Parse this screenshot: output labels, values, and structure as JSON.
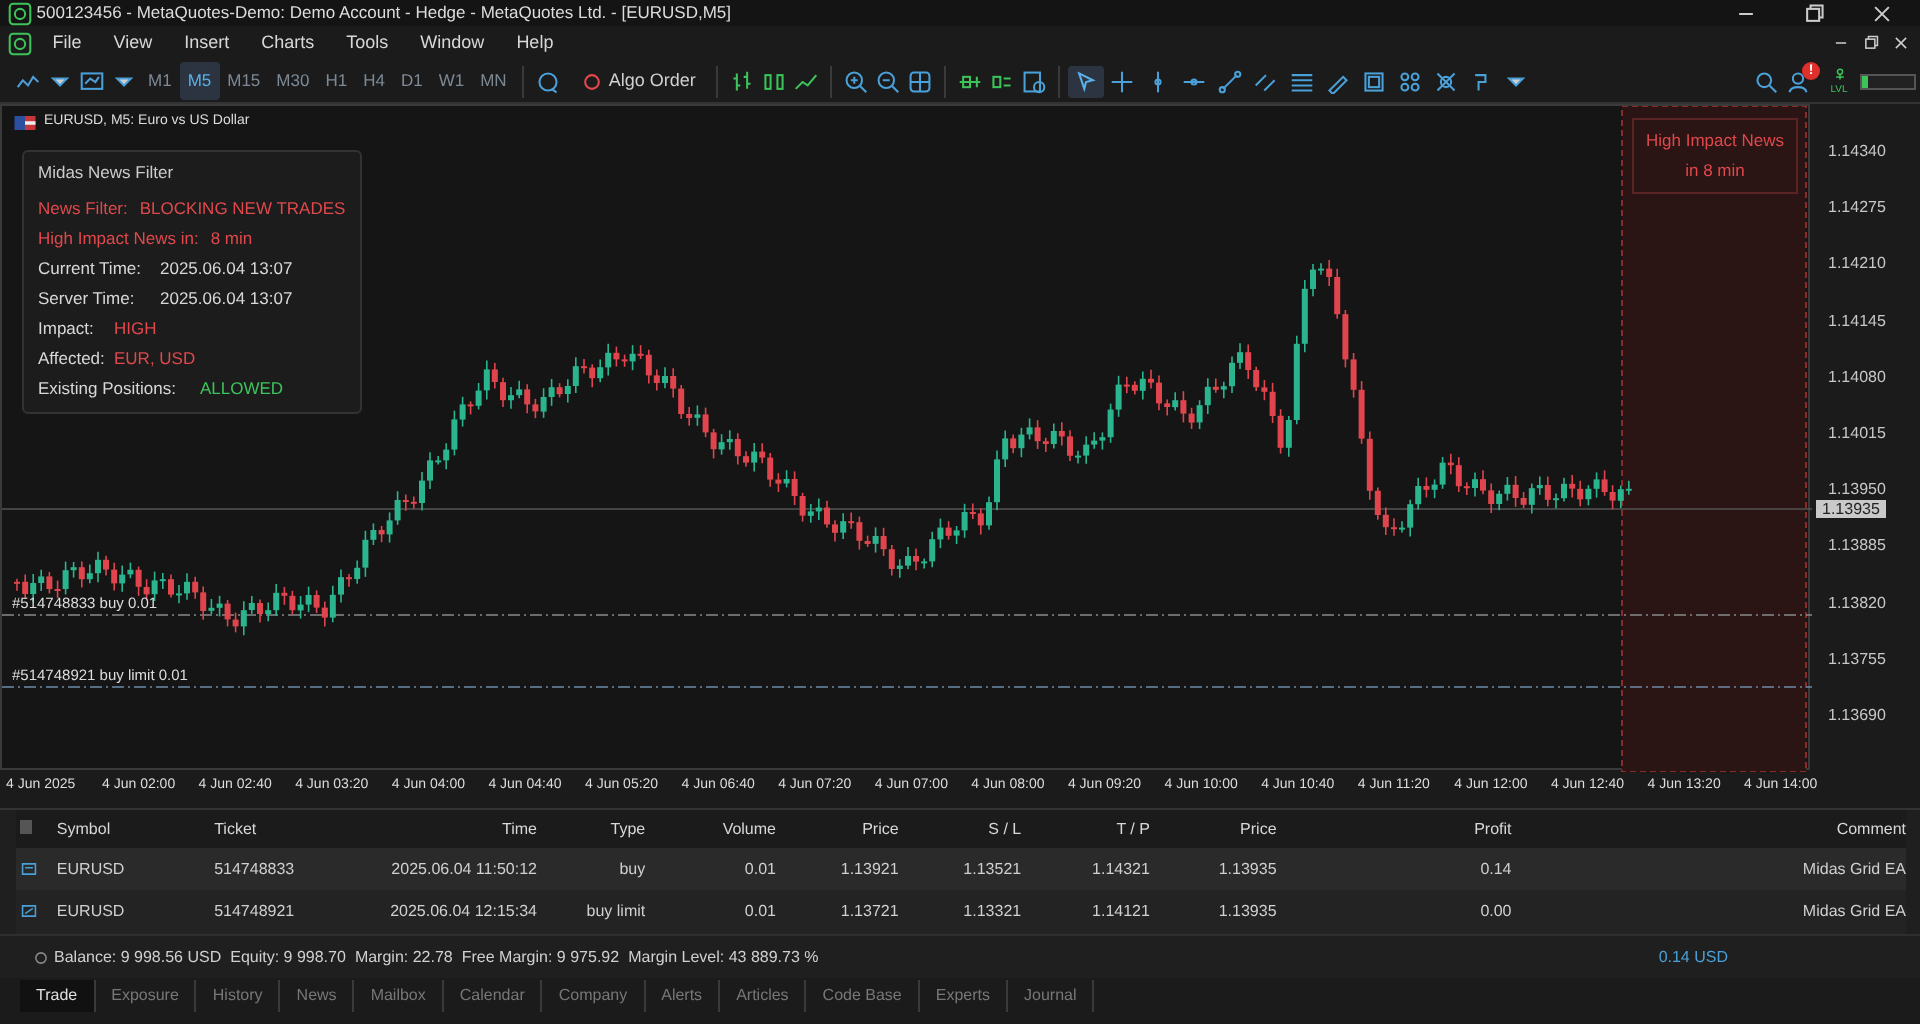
{
  "window": {
    "title": "500123456 - MetaQuotes-Demo: Demo Account - Hedge - MetaQuotes Ltd. - [EURUSD,M5]"
  },
  "menu": [
    "File",
    "View",
    "Insert",
    "Charts",
    "Tools",
    "Window",
    "Help"
  ],
  "toolbar": {
    "timeframes": [
      {
        "label": "M1",
        "selected": false
      },
      {
        "label": "M5",
        "selected": true
      },
      {
        "label": "M15",
        "selected": false
      },
      {
        "label": "M30",
        "selected": false
      },
      {
        "label": "H1",
        "selected": false
      },
      {
        "label": "H4",
        "selected": false
      },
      {
        "label": "D1",
        "selected": false
      },
      {
        "label": "W1",
        "selected": false
      },
      {
        "label": "MN",
        "selected": false
      }
    ],
    "algo_order": "Algo Order",
    "drawing_tools": [
      {
        "kind": "cursor",
        "selected": true
      },
      {
        "kind": "crosshair",
        "selected": false
      },
      {
        "kind": "vline",
        "selected": false
      },
      {
        "kind": "hline",
        "selected": false
      },
      {
        "kind": "trend",
        "selected": false
      },
      {
        "kind": "channel",
        "selected": false
      },
      {
        "kind": "fibo",
        "selected": false
      },
      {
        "kind": "pen",
        "selected": false
      },
      {
        "kind": "rect",
        "selected": false
      },
      {
        "kind": "shapes",
        "selected": false
      },
      {
        "kind": "pattern",
        "selected": false
      },
      {
        "kind": "dots",
        "selected": false
      }
    ],
    "notification_badge": "!",
    "level_label": "LVL",
    "level": 0.12
  },
  "chart": {
    "title": "EURUSD, M5: Euro vs US Dollar",
    "news_panel": {
      "title": "Midas News Filter",
      "rows": [
        {
          "label": "News Filter:",
          "value": "BLOCKING NEW TRADES",
          "kind": "alert",
          "color": "#e0484c"
        },
        {
          "label": "High Impact News in:",
          "value": "8 min",
          "kind": "alert",
          "color": "#e0484c"
        },
        {
          "label": "Current Time:",
          "value": "2025.06.04 13:07",
          "kind": "info",
          "color": "#d8d8d8"
        },
        {
          "label": "Server Time:",
          "value": "2025.06.04 13:07",
          "kind": "info",
          "color": "#d8d8d8"
        },
        {
          "label": "Impact:",
          "value": "HIGH",
          "kind": "info",
          "color": "#e0484c"
        },
        {
          "label": "Affected:",
          "value": "EUR, USD",
          "kind": "info",
          "color": "#e0484c"
        },
        {
          "label": "Existing Positions:",
          "value": "ALLOWED",
          "kind": "info",
          "color": "#3cc45a"
        }
      ]
    },
    "news_zone": [
      "High Impact News",
      "in 8 min"
    ],
    "order_lines": [
      "#514748833 buy 0.01",
      "#514748921 buy limit 0.01"
    ],
    "price_axis": [
      "1.14340",
      "1.14275",
      "1.14210",
      "1.14145",
      "1.14080",
      "1.14015",
      "1.13950",
      "1.13885",
      "1.13820",
      "1.13755",
      "1.13690"
    ],
    "current_price": "1.13935",
    "time_axis": [
      "4 Jun 2025",
      "4 Jun 02:00",
      "4 Jun 02:40",
      "4 Jun 03:20",
      "4 Jun 04:00",
      "4 Jun 04:40",
      "4 Jun 05:20",
      "4 Jun 06:40",
      "4 Jun 07:20",
      "4 Jun 07:00",
      "4 Jun 08:00",
      "4 Jun 09:20",
      "4 Jun 10:00",
      "4 Jun 10:40",
      "4 Jun 11:20",
      "4 Jun 12:00",
      "4 Jun 12:40",
      "4 Jun 13:20",
      "4 Jun 14:00"
    ]
  },
  "trade": {
    "columns": [
      "Symbol",
      "Ticket",
      "Time",
      "Type",
      "Volume",
      "Price",
      "S / L",
      "T / P",
      "Price",
      "Profit",
      "Comment"
    ],
    "rows": [
      {
        "kind": "position",
        "cells": [
          "EURUSD",
          "514748833",
          "2025.06.04 11:50:12",
          "buy",
          "0.01",
          "1.13921",
          "1.13521",
          "1.14321",
          "1.13935",
          "0.14",
          "Midas Grid EA"
        ]
      },
      {
        "kind": "order",
        "cells": [
          "EURUSD",
          "514748921",
          "2025.06.04 12:15:34",
          "buy limit",
          "0.01",
          "1.13721",
          "1.13321",
          "1.14121",
          "1.13935",
          "0.00",
          "Midas Grid EA"
        ]
      }
    ],
    "summary": [
      "Balance: 9 998.56 USD",
      "Equity: 9 998.70",
      "Margin: 22.78",
      "Free Margin: 9 975.92",
      "Margin Level: 43 889.73 %"
    ],
    "total": "0.14 USD"
  },
  "tabs": [
    {
      "label": "Trade",
      "selected": true
    },
    {
      "label": "Exposure",
      "selected": false
    },
    {
      "label": "History",
      "selected": false
    },
    {
      "label": "News",
      "selected": false
    },
    {
      "label": "Mailbox",
      "selected": false
    },
    {
      "label": "Calendar",
      "selected": false
    },
    {
      "label": "Company",
      "selected": false
    },
    {
      "label": "Alerts",
      "selected": false
    },
    {
      "label": "Articles",
      "selected": false
    },
    {
      "label": "Code Base",
      "selected": false
    },
    {
      "label": "Experts",
      "selected": false
    },
    {
      "label": "Journal",
      "selected": false
    }
  ]
}
